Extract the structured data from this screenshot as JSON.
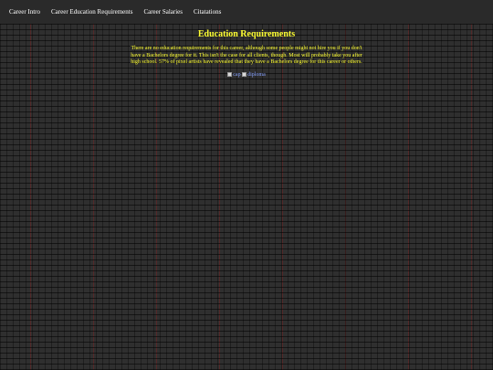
{
  "nav": {
    "items": [
      {
        "label": "Career Intro"
      },
      {
        "label": "Career Education Requirements"
      },
      {
        "label": "Career Salaries"
      },
      {
        "label": "Citatations"
      }
    ]
  },
  "content": {
    "heading": "Education Requirements",
    "paragraph": "There are no education requirements for this career, although some people might not hire you if you don't have a Bachelors degree for it. This isn't the case for all clients, though. Most will probably take you after high school. 57% of pixel artists have revealed that they have a Bachelors degree for this career or others.",
    "images": [
      {
        "alt": "cap"
      },
      {
        "alt": "diploma"
      }
    ]
  },
  "colors": {
    "background": "#2f2f2f",
    "heading": "#ffff33",
    "body_text": "#ffff33",
    "nav_text": "#ffffff"
  }
}
